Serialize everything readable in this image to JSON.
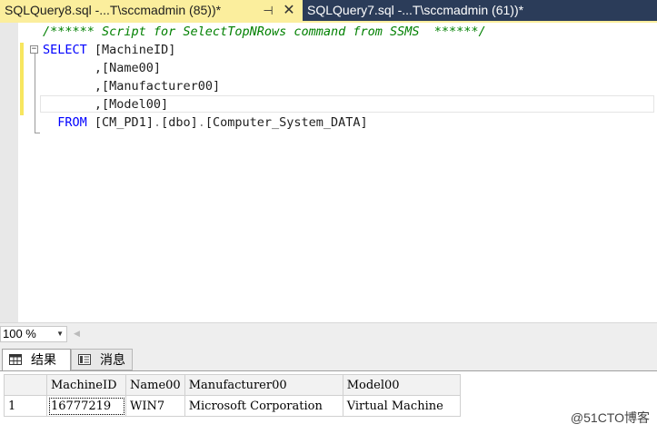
{
  "tabs": [
    {
      "title": "SQLQuery8.sql -...T\\sccmadmin (85))*",
      "active": true
    },
    {
      "title": "SQLQuery7.sql -...T\\sccmadmin (61))*",
      "active": false
    }
  ],
  "tab_pin_glyph": "⊣",
  "tab_close_glyph": "✕",
  "editor": {
    "comment": "/****** Script for SelectTopNRows command from SSMS  ******/",
    "select_kw": "SELECT",
    "col1": "[MachineID]",
    "col2": ",[Name00]",
    "col3": ",[Manufacturer00]",
    "col4": ",[Model00]",
    "from_kw": "FROM",
    "table_db": "[CM_PD1]",
    "dot1": ".",
    "table_schema": "[dbo]",
    "dot2": ".",
    "table_name": "[Computer_System_DATA]"
  },
  "zoom": {
    "value": "100 %"
  },
  "results_tabs": [
    {
      "label": "结果",
      "icon": "grid-icon"
    },
    {
      "label": "消息",
      "icon": "message-icon"
    }
  ],
  "grid": {
    "columns": [
      "MachineID",
      "Name00",
      "Manufacturer00",
      "Model00"
    ],
    "rows": [
      {
        "num": "1",
        "cells": [
          "16777219",
          "WIN7",
          "Microsoft Corporation",
          "Virtual Machine"
        ]
      }
    ]
  },
  "watermark": "@51CTO博客",
  "colors": {
    "tab_strip": "#2b3c59",
    "active_tab": "#fbee9d",
    "keyword": "#0000ff",
    "comment": "#008000"
  }
}
